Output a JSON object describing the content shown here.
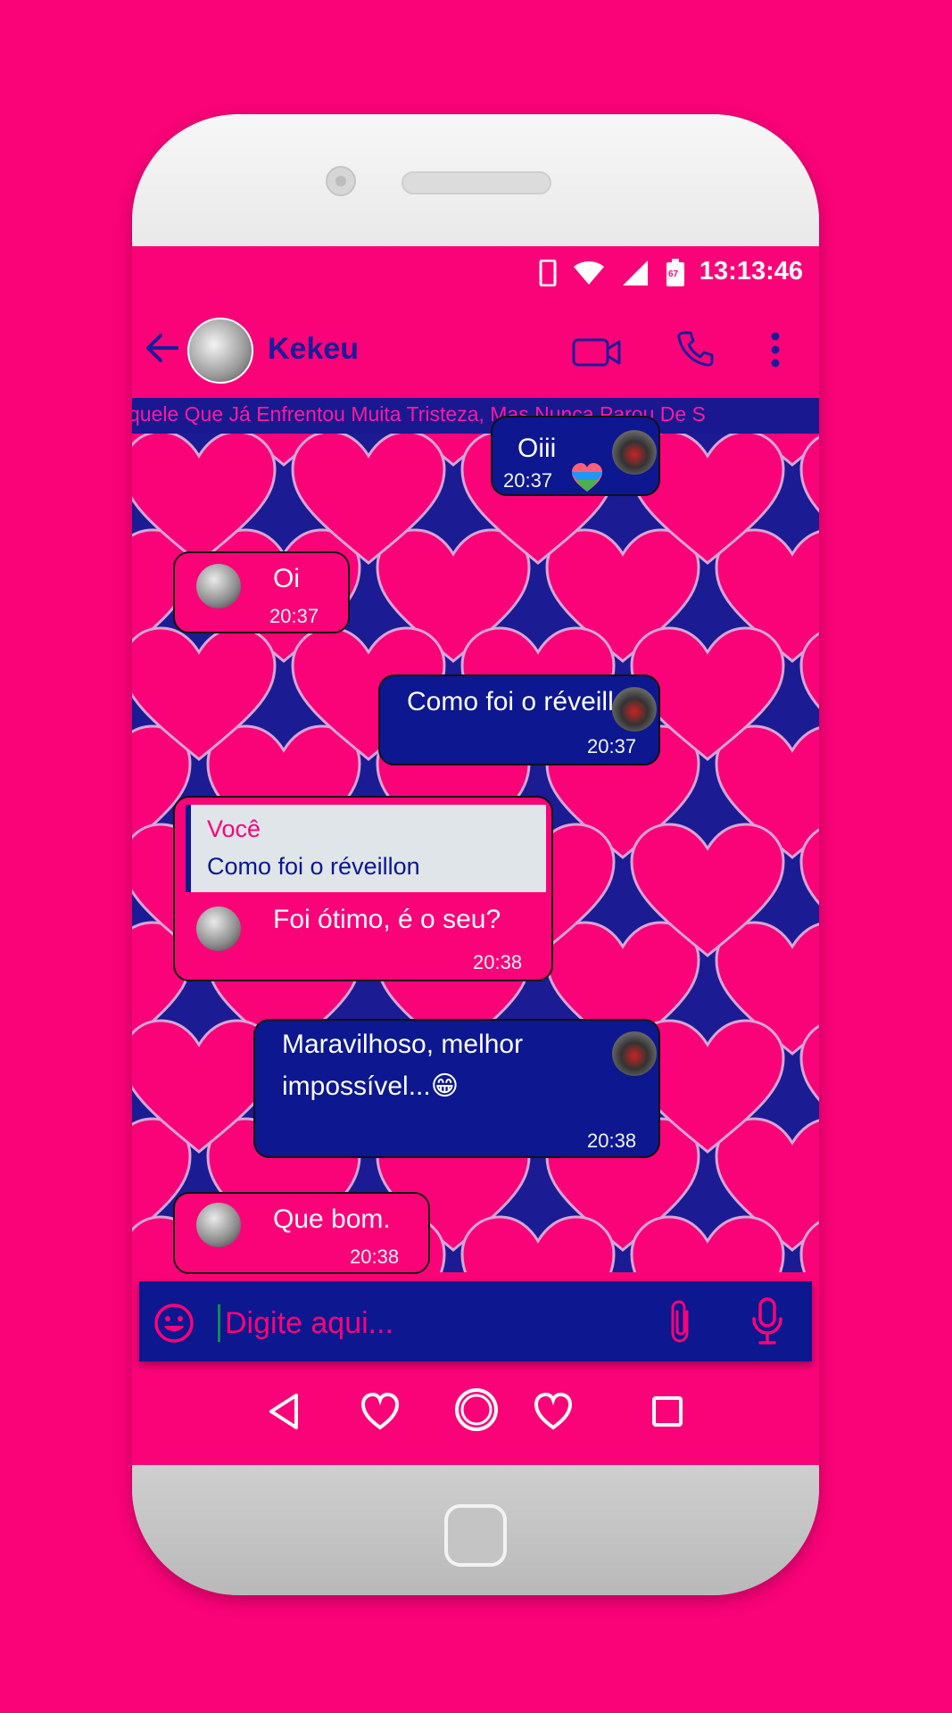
{
  "status_bar": {
    "time": "13:13:46",
    "battery": "67"
  },
  "chat": {
    "contact_name": "Kekeu",
    "banner": "quele Que Já Enfrentou Muita Tristeza, Mas Nunca Parou De S",
    "messages": [
      {
        "id": "m1",
        "direction": "out",
        "text": "Oiii",
        "time": "20:37"
      },
      {
        "id": "m2",
        "direction": "in",
        "text": "Oi",
        "time": "20:37"
      },
      {
        "id": "m3",
        "direction": "out",
        "text": "Como foi o réveillon",
        "time": "20:37"
      },
      {
        "id": "m4",
        "direction": "in",
        "reply_to_name": "Você",
        "reply_to_text": "Como foi o réveillon",
        "text": "Foi ótimo, é o seu?",
        "time": "20:38"
      },
      {
        "id": "m5",
        "direction": "out",
        "text_line1": "Maravilhoso, melhor",
        "text_line2": "impossível...😁",
        "time": "20:38"
      },
      {
        "id": "m6",
        "direction": "in",
        "text": "Que bom.",
        "time": "20:38"
      }
    ]
  },
  "composer": {
    "placeholder": "Digite aqui..."
  },
  "icons": {
    "back": "arrow-left-icon",
    "video": "video-camera-icon",
    "call": "phone-icon",
    "menu": "more-vertical-icon",
    "emoji": "emoji-icon",
    "attach": "paperclip-icon",
    "mic": "microphone-icon"
  },
  "colors": {
    "accent": "#fa0378",
    "primary": "#0c1790",
    "title": "#1b1b9a"
  }
}
